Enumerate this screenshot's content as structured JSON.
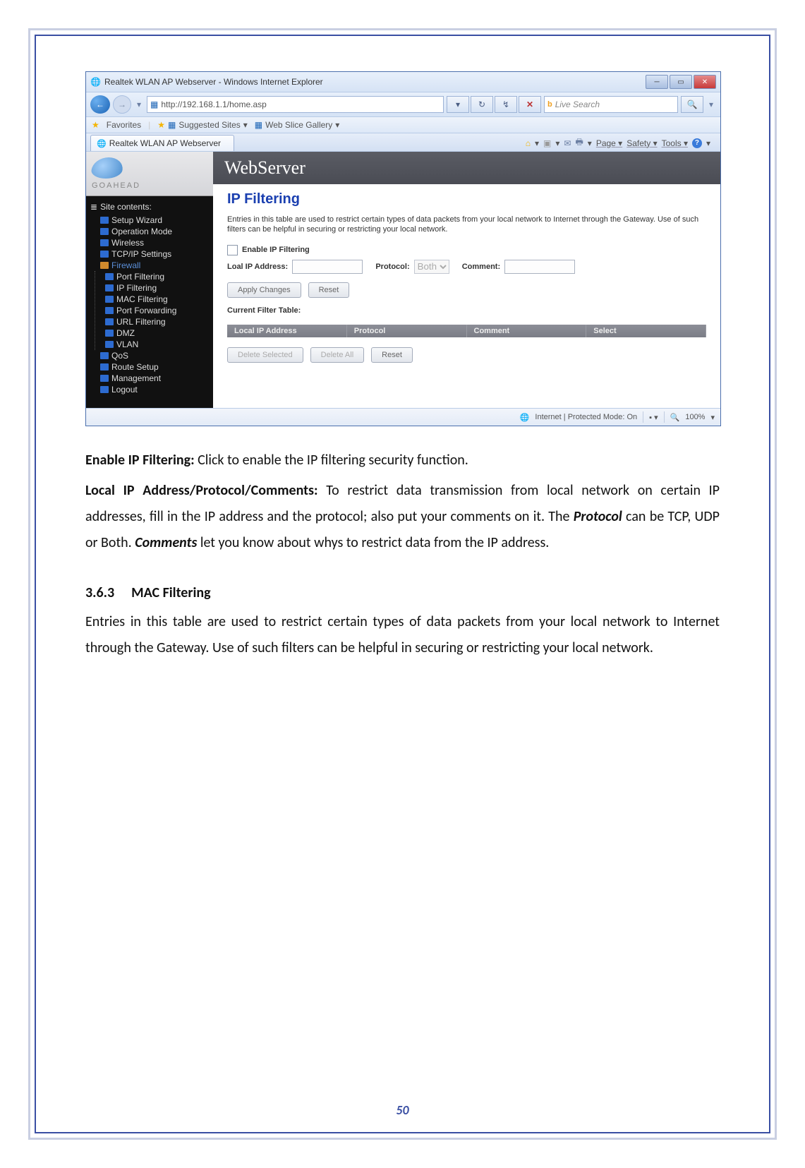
{
  "page_number": "50",
  "ie": {
    "title": "Realtek WLAN AP Webserver - Windows Internet Explorer",
    "url": "http://192.168.1.1/home.asp",
    "search_placeholder": "Live Search",
    "favorites_label": "Favorites",
    "suggested_sites": "Suggested Sites",
    "web_slice": "Web Slice Gallery",
    "tab_title": "Realtek WLAN AP Webserver",
    "cmd_page": "Page",
    "cmd_safety": "Safety",
    "cmd_tools": "Tools",
    "status_zone": "Internet | Protected Mode: On",
    "zoom": "100%"
  },
  "webserver": {
    "brand": "GOAHEAD",
    "header": "WebServer",
    "tree_title": "Site contents:",
    "items": {
      "setup_wizard": "Setup Wizard",
      "operation_mode": "Operation Mode",
      "wireless": "Wireless",
      "tcpip": "TCP/IP Settings",
      "firewall": "Firewall",
      "port_filtering": "Port Filtering",
      "ip_filtering": "IP Filtering",
      "mac_filtering": "MAC Filtering",
      "port_forwarding": "Port Forwarding",
      "url_filtering": "URL Filtering",
      "dmz": "DMZ",
      "vlan": "VLAN",
      "qos": "QoS",
      "route_setup": "Route Setup",
      "management": "Management",
      "logout": "Logout"
    }
  },
  "page": {
    "title": "IP Filtering",
    "desc": "Entries in this table are used to restrict certain types of data packets from your local network to Internet through the Gateway. Use of such filters can be helpful in securing or restricting your local network.",
    "enable_label": "Enable IP Filtering",
    "local_ip_label": "Loal IP Address:",
    "protocol_label": "Protocol:",
    "protocol_value": "Both",
    "comment_label": "Comment:",
    "apply": "Apply Changes",
    "reset": "Reset",
    "table_title": "Current Filter Table:",
    "col_local_ip": "Local IP Address",
    "col_protocol": "Protocol",
    "col_comment": "Comment",
    "col_select": "Select",
    "delete_selected": "Delete Selected",
    "delete_all": "Delete All",
    "reset2": "Reset"
  },
  "doc": {
    "p1_bold": "Enable IP Filtering:",
    "p1_rest": " Click to enable the IP filtering security function.",
    "p2_bold": "Local IP Address/Protocol/Comments:",
    "p2_rest_a": " To restrict data transmission from local network on certain IP addresses, fill in the IP address and the protocol; also put your comments on it. The ",
    "p2_em1": "Protocol",
    "p2_rest_b": " can be TCP, UDP or Both. ",
    "p2_em2": "Comments",
    "p2_rest_c": " let you know about whys to restrict data from the IP address.",
    "sec_num": "3.6.3",
    "sec_title": "MAC Filtering",
    "sec_body": "Entries in this table are used to restrict certain types of data packets from your local network to Internet through the Gateway. Use of such filters can be helpful in securing or restricting your local network."
  }
}
